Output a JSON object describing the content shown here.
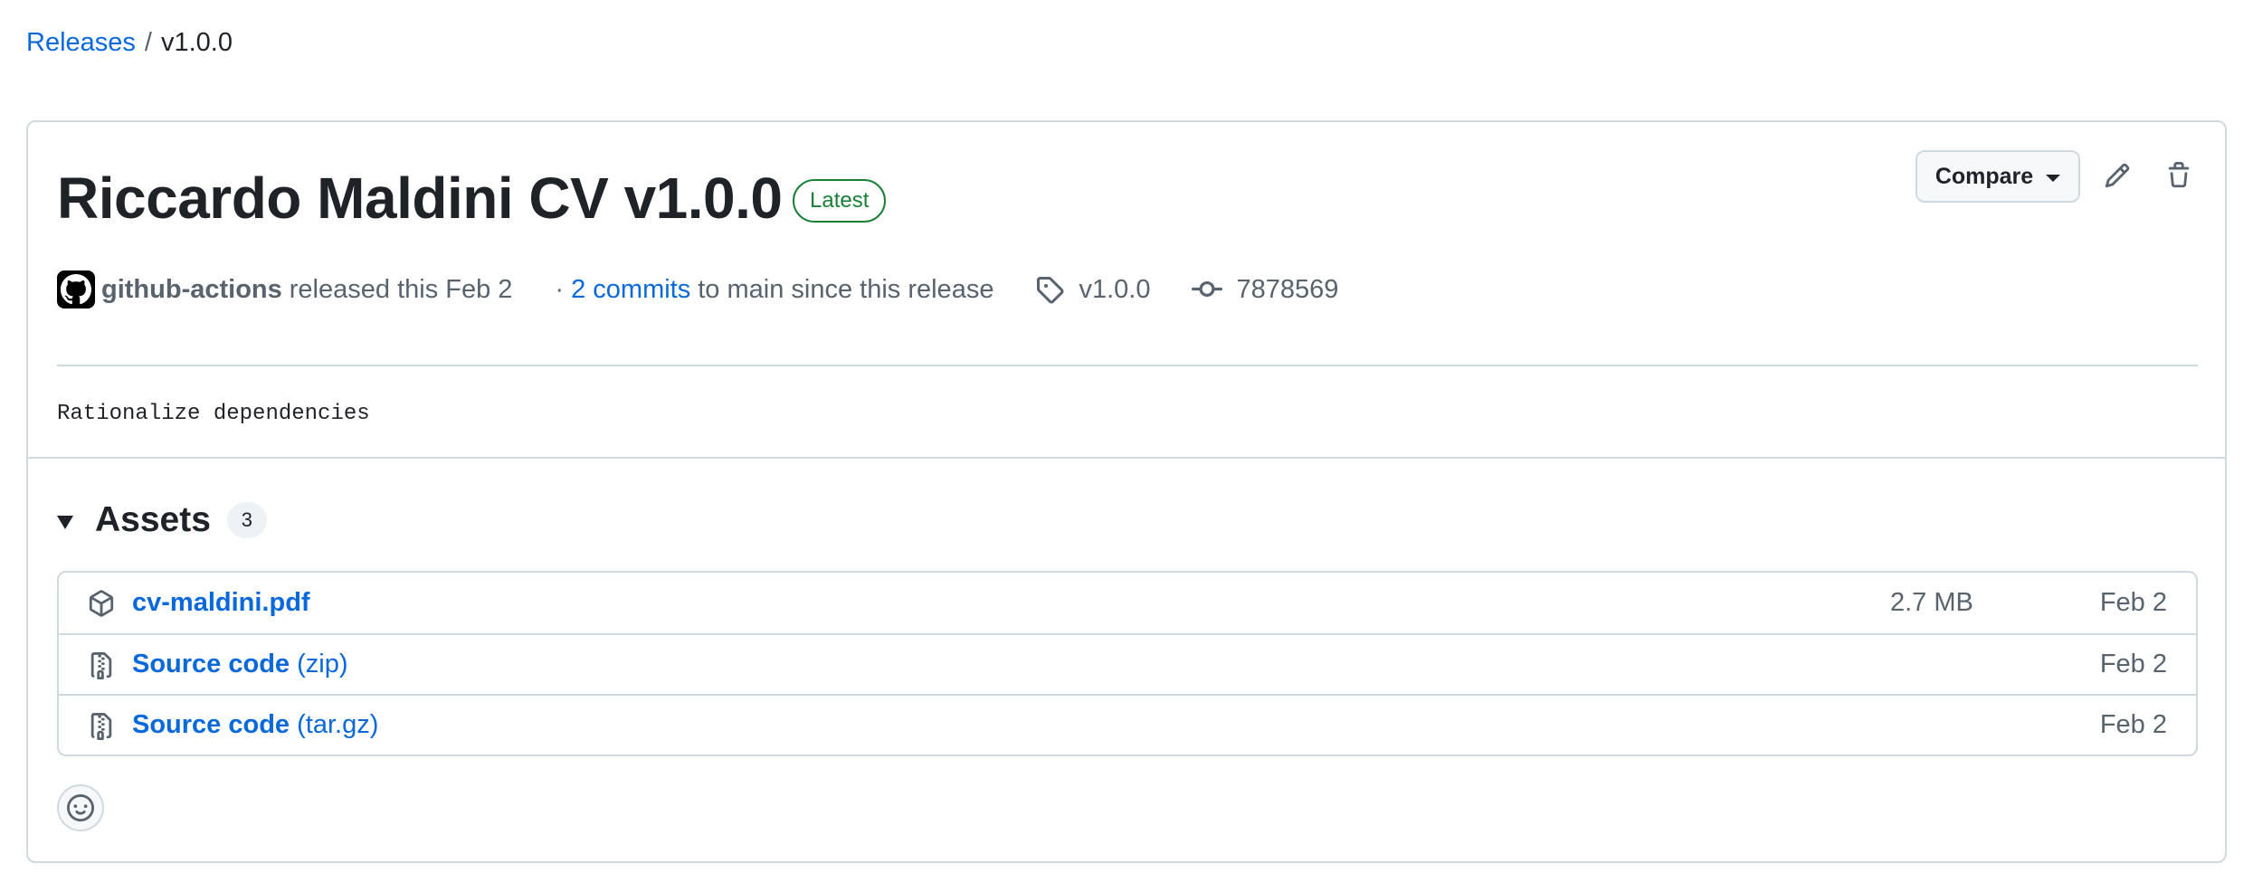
{
  "breadcrumb": {
    "root": "Releases",
    "separator": "/",
    "current": "v1.0.0"
  },
  "release": {
    "title": "Riccardo Maldini CV v1.0.0",
    "badge": "Latest",
    "author": "github-actions",
    "released_text": "released this Feb 2",
    "commits_prefix": "·",
    "commits_link": "2 commits",
    "commits_suffix": "to main since this release",
    "tag": "v1.0.0",
    "commit_sha": "7878569",
    "body": "Rationalize dependencies"
  },
  "actions": {
    "compare_label": "Compare"
  },
  "assets": {
    "title": "Assets",
    "count": "3",
    "items": [
      {
        "name": "cv-maldini.pdf",
        "suffix": "",
        "size": "2.7 MB",
        "date": "Feb 2",
        "icon": "package-icon"
      },
      {
        "name": "Source code",
        "suffix": "(zip)",
        "size": "",
        "date": "Feb 2",
        "icon": "file-zip-icon"
      },
      {
        "name": "Source code",
        "suffix": "(tar.gz)",
        "size": "",
        "date": "Feb 2",
        "icon": "file-zip-icon"
      }
    ]
  },
  "colors": {
    "link": "#0969da",
    "latest": "#1a7f37",
    "border": "#d1d9e0",
    "muted": "#59636e"
  }
}
